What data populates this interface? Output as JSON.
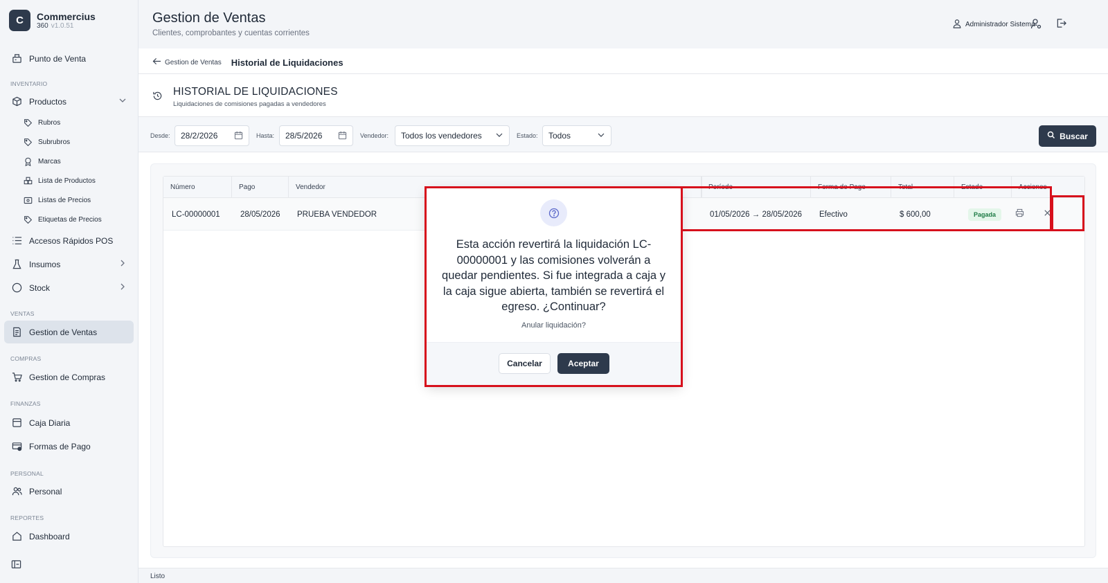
{
  "brand": {
    "logo": "C",
    "name": "Commercius",
    "sub": "360",
    "version": "v1.0.51"
  },
  "sidebar": {
    "items": [
      {
        "label": "Punto de Venta",
        "icon": "pos-icon"
      },
      {
        "section": "INVENTARIO"
      },
      {
        "label": "Productos",
        "icon": "box-icon"
      },
      {
        "label": "Rubros",
        "icon": "tag-icon"
      },
      {
        "label": "Subrubros",
        "icon": "tag-icon"
      },
      {
        "label": "Marcas",
        "icon": "award-icon"
      },
      {
        "label": "Lista de Productos",
        "icon": "boxes-icon"
      },
      {
        "label": "Listas de Precios",
        "icon": "price-list-icon"
      },
      {
        "label": "Etiquetas de Precios",
        "icon": "tag-icon"
      },
      {
        "label": "Accesos Rápidos POS",
        "icon": "list-icon"
      },
      {
        "label": "Insumos",
        "icon": "flask-icon"
      },
      {
        "label": "Stock",
        "icon": "circle-icon"
      },
      {
        "section": "VENTAS"
      },
      {
        "label": "Gestion de Ventas",
        "icon": "receipt-icon"
      },
      {
        "section": "COMPRAS"
      },
      {
        "label": "Gestion de Compras",
        "icon": "cart-icon"
      },
      {
        "section": "FINANZAS"
      },
      {
        "label": "Caja Diaria",
        "icon": "cash-icon"
      },
      {
        "label": "Formas de Pago",
        "icon": "payment-icon"
      },
      {
        "section": "PERSONAL"
      },
      {
        "label": "Personal",
        "icon": "users-icon"
      },
      {
        "section": "REPORTES"
      },
      {
        "label": "Dashboard",
        "icon": "home-icon"
      }
    ]
  },
  "header": {
    "title": "Gestion de Ventas",
    "subtitle": "Clientes, comprobantes y cuentas corrientes",
    "user": "Administrador Sistema"
  },
  "breadcrumb": {
    "back": "Gestion de Ventas",
    "current": "Historial de Liquidaciones"
  },
  "section": {
    "title": "HISTORIAL DE LIQUIDACIONES",
    "subtitle": "Liquidaciones de comisiones pagadas a vendedores"
  },
  "filters": {
    "desde_label": "Desde:",
    "desde_value": "28/2/2026",
    "hasta_label": "Hasta:",
    "hasta_value": "28/5/2026",
    "vendedor_label": "Vendedor:",
    "vendedor_value": "Todos los vendedores",
    "estado_label": "Estado:",
    "estado_value": "Todos",
    "search_label": "Buscar"
  },
  "table": {
    "headers": [
      "Número",
      "Pago",
      "Vendedor",
      "",
      "Período",
      "Forma de Pago",
      "Total",
      "Estado",
      "Acciones"
    ],
    "rows": [
      {
        "numero": "LC-00000001",
        "pago": "28/05/2026",
        "vendedor": "PRUEBA VENDEDOR",
        "periodo": "01/05/2026 → 28/05/2026",
        "forma_pago": "Efectivo",
        "total": "$ 600,00",
        "estado": "Pagada"
      }
    ]
  },
  "modal": {
    "message": "Esta acción revertirá la liquidación LC-00000001 y las comisiones volverán a quedar pendientes. Si fue integrada a caja y la caja sigue abierta, también se revertirá el egreso. ¿Continuar?",
    "question": "Anular liquidación?",
    "cancel": "Cancelar",
    "accept": "Aceptar"
  },
  "status": "Listo",
  "colors": {
    "primary": "#2e3a4c",
    "highlight": "#d7101c",
    "badge_bg": "#e4f6ea",
    "badge_text": "#1e7b45"
  }
}
